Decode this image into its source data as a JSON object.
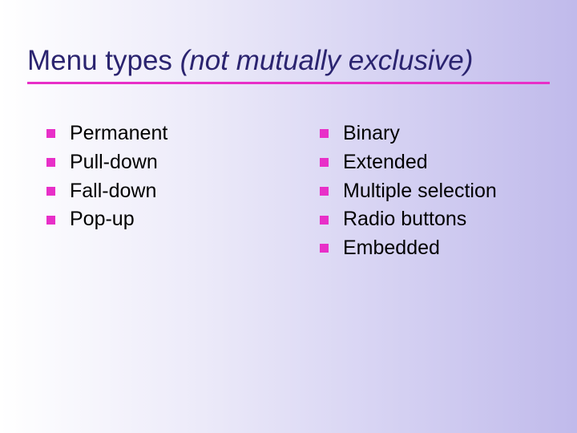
{
  "title": {
    "main": "Menu types ",
    "qualifier": "(not mutually exclusive)"
  },
  "left_items": [
    "Permanent",
    "Pull-down",
    "Fall-down",
    "Pop-up"
  ],
  "right_items": [
    "Binary",
    "Extended",
    "Multiple selection",
    "Radio buttons",
    "Embedded"
  ]
}
